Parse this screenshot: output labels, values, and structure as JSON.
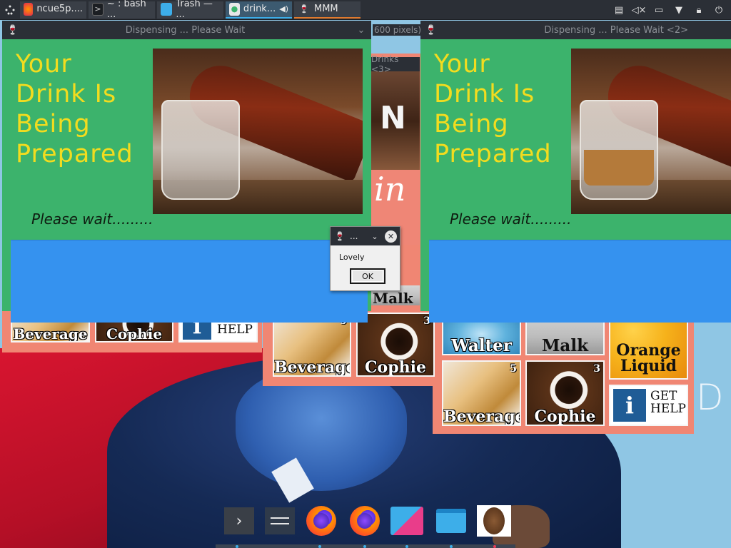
{
  "panel": {
    "tasks": [
      {
        "label": "ncue5p....",
        "icon": "firefox-icon"
      },
      {
        "label": "~ : bash ...",
        "icon": "terminal-icon"
      },
      {
        "label": "Trash — ...",
        "icon": "folder-icon"
      },
      {
        "label": "drink...",
        "icon": "drinks-app-icon",
        "active": true
      },
      {
        "label": "MMM",
        "icon": "wine-glass-icon"
      }
    ],
    "tray": [
      "clipboard-icon",
      "volume-muted-icon",
      "network-icon",
      "expand-arrow-icon",
      "lock-icon",
      "power-icon"
    ]
  },
  "windows": {
    "dispensing_1": {
      "title": "Dispensing ... Please Wait",
      "heading": [
        "Your",
        "Drink Is",
        "Being",
        "Prepared"
      ],
      "wait": "Please wait.........",
      "fill": 0
    },
    "dispensing_2": {
      "title": "Dispensing ... Please Wait <2>",
      "heading": [
        "Your",
        "Drink Is",
        "Being",
        "Prepared"
      ],
      "wait": "Please wait.........",
      "fill": 0.45
    },
    "background_drinks": {
      "title_fragment": "Drinks <3>",
      "size_fragment": "600 pixels)"
    }
  },
  "menu_tiles": {
    "left": [
      {
        "label": "Beverage",
        "image": "beverage"
      },
      {
        "label": "Cophie",
        "image": "cophie"
      },
      {
        "label": "GET HELP",
        "image": "help"
      }
    ],
    "middle": [
      {
        "label": "Malk",
        "image": "malk"
      },
      {
        "label": "Beverage",
        "image": "beverage",
        "number": "5"
      },
      {
        "label": "Cophie",
        "image": "cophie",
        "number": "3"
      }
    ],
    "right": [
      {
        "label": "Walter",
        "image": "walter"
      },
      {
        "label": "Malk",
        "image": "malk"
      },
      {
        "label": "Orange Liquid",
        "image": "orange"
      },
      {
        "label": "Beverage",
        "image": "beverage",
        "number": "5"
      },
      {
        "label": "Cophie",
        "image": "cophie",
        "number": "3"
      },
      {
        "label": "GET HELP",
        "image": "help"
      }
    ]
  },
  "help": {
    "line1": "GET",
    "line2": "HELP"
  },
  "dialog": {
    "title": "...",
    "message": "Lovely",
    "ok_label": "OK"
  },
  "dock": {
    "items": [
      "show-more-icon",
      "settings-icon",
      "firefox-icon",
      "firefox-icon",
      "kde-connect-icon",
      "file-manager-icon",
      "coffee-bean-icon"
    ]
  },
  "colors": {
    "dispensing_bg": "#3cb36c",
    "heading": "#f2dc1f",
    "progress_bar": "#3592ef",
    "menu_bg": "#f08673",
    "panel": "#2b2f36"
  }
}
